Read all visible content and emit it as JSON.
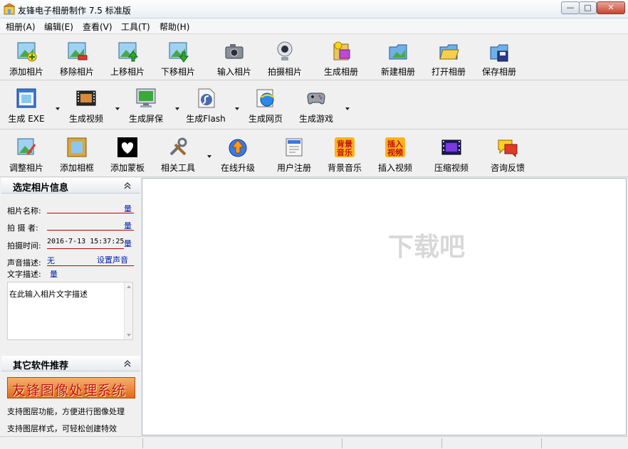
{
  "window": {
    "title": "友锋电子相册制作 7.5 标准版",
    "min_glyph": "—",
    "max_glyph": "□",
    "close_glyph": "✕"
  },
  "menu": [
    "相册(A)",
    "编辑(E)",
    "查看(V)",
    "工具(T)",
    "帮助(H)"
  ],
  "toolbar1": [
    "添加相片",
    "移除相片",
    "上移相片",
    "下移相片",
    "输入相片",
    "拍摄相片",
    "生成相册",
    "新建相册",
    "打开相册",
    "保存相册"
  ],
  "toolbar2": [
    "生成 EXE",
    "生成视频",
    "生成屏保",
    "生成Flash",
    "生成网页",
    "生成游戏"
  ],
  "toolbar3": [
    "调整相片",
    "添加相框",
    "添加蒙板",
    "相关工具",
    "在线升级",
    "用户注册",
    "背景音乐",
    "插入视频",
    "压缩视频",
    "咨询反馈"
  ],
  "info_panel": {
    "title": "选定相片信息",
    "name_label": "相片名称:",
    "name_value": "",
    "name_qty": "量",
    "photographer_label": "拍 摄 者:",
    "photographer_value": "",
    "photographer_qty": "量",
    "time_label": "拍摄时间:",
    "time_value": "2016-7-13 15:37:25",
    "time_qty": "量",
    "sound_label": "声音描述:",
    "sound_value": "无",
    "sound_button": "设置声音",
    "text_label": "文字描述:",
    "text_qty": "量",
    "text_placeholder": "在此输入相片文字描述"
  },
  "recommend_panel": {
    "title": "其它软件推荐",
    "banner_text": "友锋图像处理系统",
    "lines": [
      "支持图层功能，方便进行图像处理",
      "支持图层样式，可轻松创建特效"
    ]
  },
  "colors": {
    "accent_blue": "#0020a8",
    "underline_red": "#c40000",
    "banner_orange": "#e06b1d"
  },
  "watermark": "下载吧"
}
